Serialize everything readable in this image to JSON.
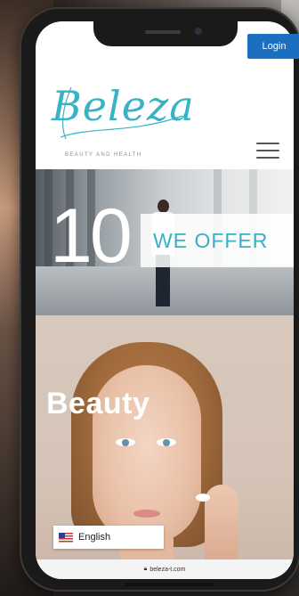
{
  "header": {
    "login_label": "Login",
    "logo_text": "Beleza",
    "logo_tagline": "BEAUTY AND HEALTH"
  },
  "hero": {
    "number": "10",
    "offer_text": "WE OFFER"
  },
  "beauty": {
    "title": "Beauty"
  },
  "language": {
    "label": "English"
  },
  "browser": {
    "url": "beleza-t.com"
  },
  "colors": {
    "accent": "#39b0c3",
    "login_bg": "#1a6fc0"
  }
}
